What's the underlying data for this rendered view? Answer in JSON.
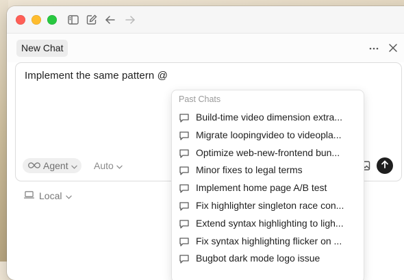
{
  "tab": {
    "label": "New Chat"
  },
  "composer": {
    "text": "Implement the same pattern @",
    "mode_label": "Agent",
    "model_label": "Auto"
  },
  "environment": {
    "label": "Local"
  },
  "past_chats": {
    "header": "Past Chats",
    "items": [
      {
        "label": "Build-time video dimension extra..."
      },
      {
        "label": "Migrate loopingvideo to videopla..."
      },
      {
        "label": "Optimize web-new-frontend bun..."
      },
      {
        "label": "Minor fixes to legal terms"
      },
      {
        "label": "Implement home page A/B test"
      },
      {
        "label": "Fix highlighter singleton race con..."
      },
      {
        "label": "Extend syntax highlighting to ligh..."
      },
      {
        "label": "Fix syntax highlighting flicker on ..."
      },
      {
        "label": "Bugbot dark mode logo issue"
      }
    ]
  },
  "icons": {
    "sidebar": "sidebar-toggle-icon",
    "compose": "compose-icon",
    "back": "arrow-left-icon",
    "forward": "arrow-right-icon",
    "more": "more-horizontal-icon",
    "close": "close-icon",
    "agent": "infinity-icon",
    "image": "image-icon",
    "send": "arrow-up-icon",
    "local": "laptop-icon",
    "chat": "chat-bubble-icon"
  },
  "colors": {
    "close_light": "#ff5f57",
    "minimize_light": "#febc2e",
    "zoom_light": "#28c840",
    "send_button": "#1f1f1f"
  }
}
